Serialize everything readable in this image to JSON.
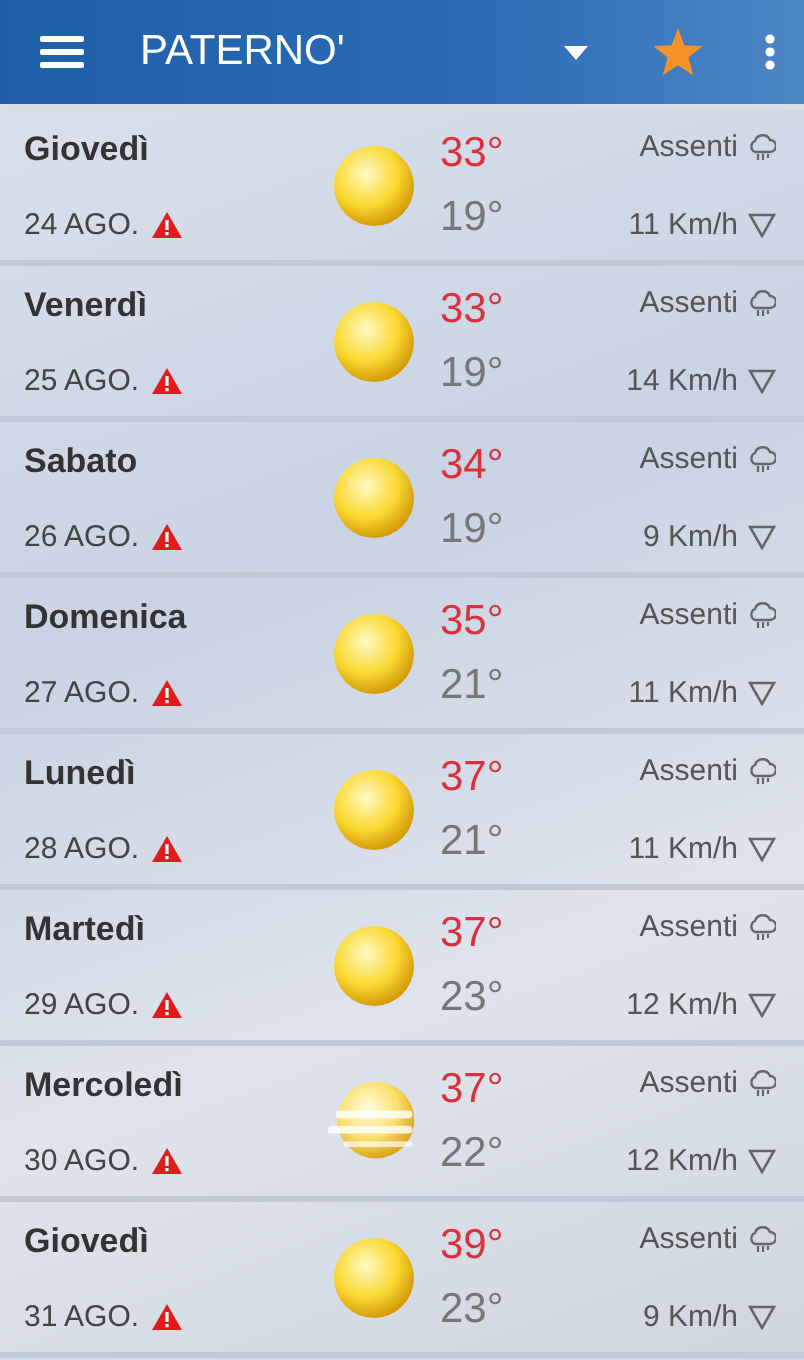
{
  "header": {
    "title": "PATERNO'"
  },
  "days": [
    {
      "day": "Giovedì",
      "date": "24 AGO.",
      "alert": true,
      "kind": "sun",
      "max": "33°",
      "min": "19°",
      "rain": "Assenti",
      "wind": "11 Km/h"
    },
    {
      "day": "Venerdì",
      "date": "25 AGO.",
      "alert": true,
      "kind": "sun",
      "max": "33°",
      "min": "19°",
      "rain": "Assenti",
      "wind": "14 Km/h"
    },
    {
      "day": "Sabato",
      "date": "26 AGO.",
      "alert": true,
      "kind": "sun",
      "max": "34°",
      "min": "19°",
      "rain": "Assenti",
      "wind": "9 Km/h"
    },
    {
      "day": "Domenica",
      "date": "27 AGO.",
      "alert": true,
      "kind": "sun",
      "max": "35°",
      "min": "21°",
      "rain": "Assenti",
      "wind": "11 Km/h"
    },
    {
      "day": "Lunedì",
      "date": "28 AGO.",
      "alert": true,
      "kind": "sun",
      "max": "37°",
      "min": "21°",
      "rain": "Assenti",
      "wind": "11 Km/h"
    },
    {
      "day": "Martedì",
      "date": "29 AGO.",
      "alert": true,
      "kind": "sun",
      "max": "37°",
      "min": "23°",
      "rain": "Assenti",
      "wind": "12 Km/h"
    },
    {
      "day": "Mercoledì",
      "date": "30 AGO.",
      "alert": true,
      "kind": "haze",
      "max": "37°",
      "min": "22°",
      "rain": "Assenti",
      "wind": "12 Km/h"
    },
    {
      "day": "Giovedì",
      "date": "31 AGO.",
      "alert": true,
      "kind": "sun",
      "max": "39°",
      "min": "23°",
      "rain": "Assenti",
      "wind": "9 Km/h"
    }
  ]
}
